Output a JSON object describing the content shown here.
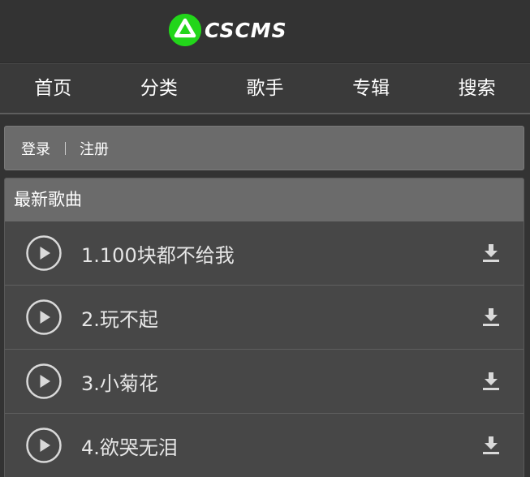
{
  "header": {
    "logo_text": "CSCMS",
    "brand_color": "#22d61a"
  },
  "nav": {
    "items": [
      {
        "label": "首页"
      },
      {
        "label": "分类"
      },
      {
        "label": "歌手"
      },
      {
        "label": "专辑"
      },
      {
        "label": "搜索"
      }
    ]
  },
  "account": {
    "login_label": "登录",
    "register_label": "注册"
  },
  "latest": {
    "title": "最新歌曲",
    "songs": [
      {
        "title": "1.100块都不给我",
        "play_icon": "play-circle-icon",
        "download_icon": "download-icon"
      },
      {
        "title": "2.玩不起",
        "play_icon": "play-circle-icon",
        "download_icon": "download-icon"
      },
      {
        "title": "3.小菊花",
        "play_icon": "play-circle-icon",
        "download_icon": "download-icon"
      },
      {
        "title": "4.欲哭无泪",
        "play_icon": "play-circle-icon",
        "download_icon": "download-icon"
      }
    ]
  }
}
